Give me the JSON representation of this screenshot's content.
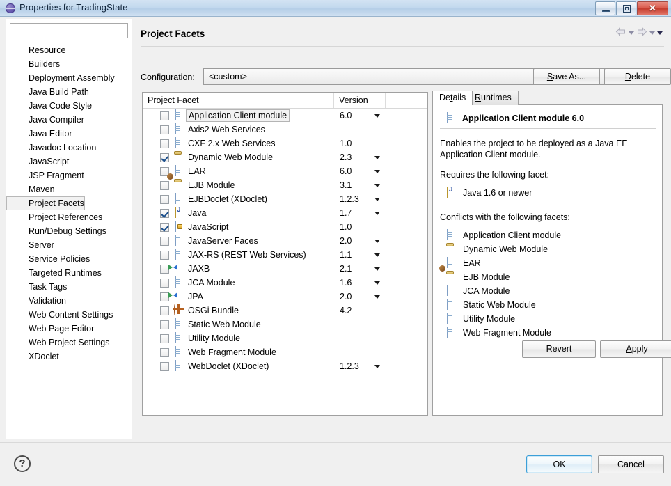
{
  "window": {
    "title": "Properties for TradingState",
    "icon": "eclipse-properties-icon",
    "minimize_label": "",
    "maximize_label": "",
    "close_label": "✕"
  },
  "sidebar": {
    "filter_placeholder": "",
    "filter_value": "",
    "items": [
      {
        "label": "Resource",
        "selected": false
      },
      {
        "label": "Builders",
        "selected": false
      },
      {
        "label": "Deployment Assembly",
        "selected": false
      },
      {
        "label": "Java Build Path",
        "selected": false
      },
      {
        "label": "Java Code Style",
        "selected": false
      },
      {
        "label": "Java Compiler",
        "selected": false
      },
      {
        "label": "Java Editor",
        "selected": false
      },
      {
        "label": "Javadoc Location",
        "selected": false
      },
      {
        "label": "JavaScript",
        "selected": false
      },
      {
        "label": "JSP Fragment",
        "selected": false
      },
      {
        "label": "Maven",
        "selected": false
      },
      {
        "label": "Project Facets",
        "selected": true
      },
      {
        "label": "Project References",
        "selected": false
      },
      {
        "label": "Run/Debug Settings",
        "selected": false
      },
      {
        "label": "Server",
        "selected": false
      },
      {
        "label": "Service Policies",
        "selected": false
      },
      {
        "label": "Targeted Runtimes",
        "selected": false
      },
      {
        "label": "Task Tags",
        "selected": false
      },
      {
        "label": "Validation",
        "selected": false
      },
      {
        "label": "Web Content Settings",
        "selected": false
      },
      {
        "label": "Web Page Editor",
        "selected": false
      },
      {
        "label": "Web Project Settings",
        "selected": false
      },
      {
        "label": "XDoclet",
        "selected": false
      }
    ]
  },
  "page": {
    "title": "Project Facets",
    "nav": {
      "back": "back-arrow",
      "forward": "forward-arrow",
      "menu": "view-menu-caret"
    }
  },
  "configuration": {
    "label": "Configuration:",
    "label_mnemonic": "C",
    "value": "<custom>",
    "save_as_label": "Save As...",
    "save_as_mnemonic": "S",
    "delete_label": "Delete",
    "delete_mnemonic": "D"
  },
  "facet_table": {
    "columns": [
      "Project Facet",
      "Version",
      ""
    ],
    "rows": [
      {
        "name": "Application Client module",
        "version": "6.0",
        "checked": false,
        "selected": true,
        "icon": "doc",
        "has_dropdown": true
      },
      {
        "name": "Axis2 Web Services",
        "version": "",
        "checked": false,
        "selected": false,
        "icon": "doc",
        "has_dropdown": false
      },
      {
        "name": "CXF 2.x Web Services",
        "version": "1.0",
        "checked": false,
        "selected": false,
        "icon": "doc",
        "has_dropdown": false
      },
      {
        "name": "Dynamic Web Module",
        "version": "2.3",
        "checked": true,
        "selected": false,
        "icon": "web",
        "has_dropdown": true
      },
      {
        "name": "EAR",
        "version": "6.0",
        "checked": false,
        "selected": false,
        "icon": "doc",
        "has_dropdown": true
      },
      {
        "name": "EJB Module",
        "version": "3.1",
        "checked": false,
        "selected": false,
        "icon": "ejb",
        "has_dropdown": true
      },
      {
        "name": "EJBDoclet (XDoclet)",
        "version": "1.2.3",
        "checked": false,
        "selected": false,
        "icon": "doc",
        "has_dropdown": true
      },
      {
        "name": "Java",
        "version": "1.7",
        "checked": true,
        "selected": false,
        "icon": "java",
        "has_dropdown": true
      },
      {
        "name": "JavaScript",
        "version": "1.0",
        "checked": true,
        "selected": false,
        "icon": "js",
        "has_dropdown": false
      },
      {
        "name": "JavaServer Faces",
        "version": "2.0",
        "checked": false,
        "selected": false,
        "icon": "doc",
        "has_dropdown": true
      },
      {
        "name": "JAX-RS (REST Web Services)",
        "version": "1.1",
        "checked": false,
        "selected": false,
        "icon": "doc",
        "has_dropdown": true
      },
      {
        "name": "JAXB",
        "version": "2.1",
        "checked": false,
        "selected": false,
        "icon": "xml",
        "has_dropdown": true
      },
      {
        "name": "JCA Module",
        "version": "1.6",
        "checked": false,
        "selected": false,
        "icon": "doc",
        "has_dropdown": true
      },
      {
        "name": "JPA",
        "version": "2.0",
        "checked": false,
        "selected": false,
        "icon": "xml",
        "has_dropdown": true
      },
      {
        "name": "OSGi Bundle",
        "version": "4.2",
        "checked": false,
        "selected": false,
        "icon": "osgi",
        "has_dropdown": false
      },
      {
        "name": "Static Web Module",
        "version": "",
        "checked": false,
        "selected": false,
        "icon": "doc",
        "has_dropdown": false
      },
      {
        "name": "Utility Module",
        "version": "",
        "checked": false,
        "selected": false,
        "icon": "doc",
        "has_dropdown": false
      },
      {
        "name": "Web Fragment Module",
        "version": "",
        "checked": false,
        "selected": false,
        "icon": "doc",
        "has_dropdown": false
      },
      {
        "name": "WebDoclet (XDoclet)",
        "version": "1.2.3",
        "checked": false,
        "selected": false,
        "icon": "doc",
        "has_dropdown": true
      }
    ]
  },
  "details": {
    "tabs": [
      {
        "label": "Details",
        "mnemonic": "t",
        "active": true
      },
      {
        "label": "Runtimes",
        "mnemonic": "R",
        "active": false
      }
    ],
    "heading": "Application Client module 6.0",
    "heading_icon": "doc",
    "description": "Enables the project to be deployed as a Java EE Application Client module.",
    "requires_label": "Requires the following facet:",
    "requires": [
      {
        "label": "Java 1.6 or newer",
        "icon": "java"
      }
    ],
    "conflicts_label": "Conflicts with the following facets:",
    "conflicts": [
      {
        "label": "Application Client module",
        "icon": "doc"
      },
      {
        "label": "Dynamic Web Module",
        "icon": "web"
      },
      {
        "label": "EAR",
        "icon": "doc"
      },
      {
        "label": "EJB Module",
        "icon": "ejb"
      },
      {
        "label": "JCA Module",
        "icon": "doc"
      },
      {
        "label": "Static Web Module",
        "icon": "doc"
      },
      {
        "label": "Utility Module",
        "icon": "doc"
      },
      {
        "label": "Web Fragment Module",
        "icon": "doc"
      }
    ]
  },
  "actions": {
    "revert_label": "Revert",
    "apply_label": "Apply",
    "apply_mnemonic": "A",
    "help_label": "?",
    "ok_label": "OK",
    "cancel_label": "Cancel"
  },
  "colors": {
    "titlebar": "#c3d9ee",
    "close_button": "#c43b2c",
    "ok_focus_border": "#3c9fd8",
    "dialog_bg": "#f0f0f0"
  }
}
